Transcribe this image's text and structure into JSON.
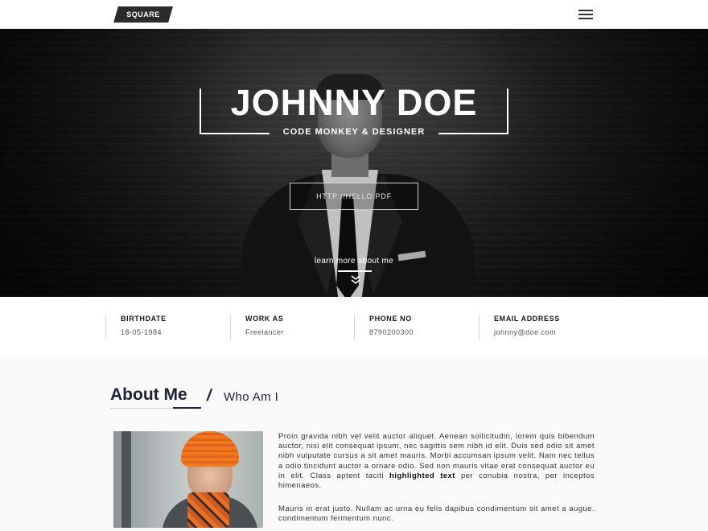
{
  "header": {
    "logo_text": "SQUARE",
    "menu_icon": "hamburger-menu-icon"
  },
  "hero": {
    "name": "JOHNNY DOE",
    "role": "CODE MONKEY & DESIGNER",
    "cta_label": "HTTP://HELLO.PDF",
    "learn_more": "learn more about me",
    "scroll_icon": "double-chevron-down-icon"
  },
  "info": [
    {
      "label": "BIRTHDATE",
      "value": "18-05-1984"
    },
    {
      "label": "WORK AS",
      "value": "Freelancer"
    },
    {
      "label": "PHONE NO",
      "value": "8790200300"
    },
    {
      "label": "EMAIL ADDRESS",
      "value": "johnny@doe.com"
    }
  ],
  "about": {
    "title": "About Me",
    "slash": "/",
    "subtitle": "Who Am I",
    "para1_before": "Proin gravida nibh vel velit auctor aliquet. Aenean sollicitudin, lorem quis bibendum auctor, nisi elit consequat ipsum, nec sagittis sem nibh id elit. Duis sed odio sit amet nibh vulputate cursus a sit amet mauris. Morbi accumsan ipsum velit. Nam nec tellus a odio tincidunt auctor a ornare odio. Sed non mauris vitae erat consequat auctor eu in elit. Class aptent taciti ",
    "para1_highlight": "highlighted text",
    "para1_after": " per conubia nostra, per inceptos himenaeos.",
    "para2": "Mauris in erat justo. Nullam ac urna eu felis dapibus condimentum sit amet a augue. condimentum fermentum nunc."
  }
}
